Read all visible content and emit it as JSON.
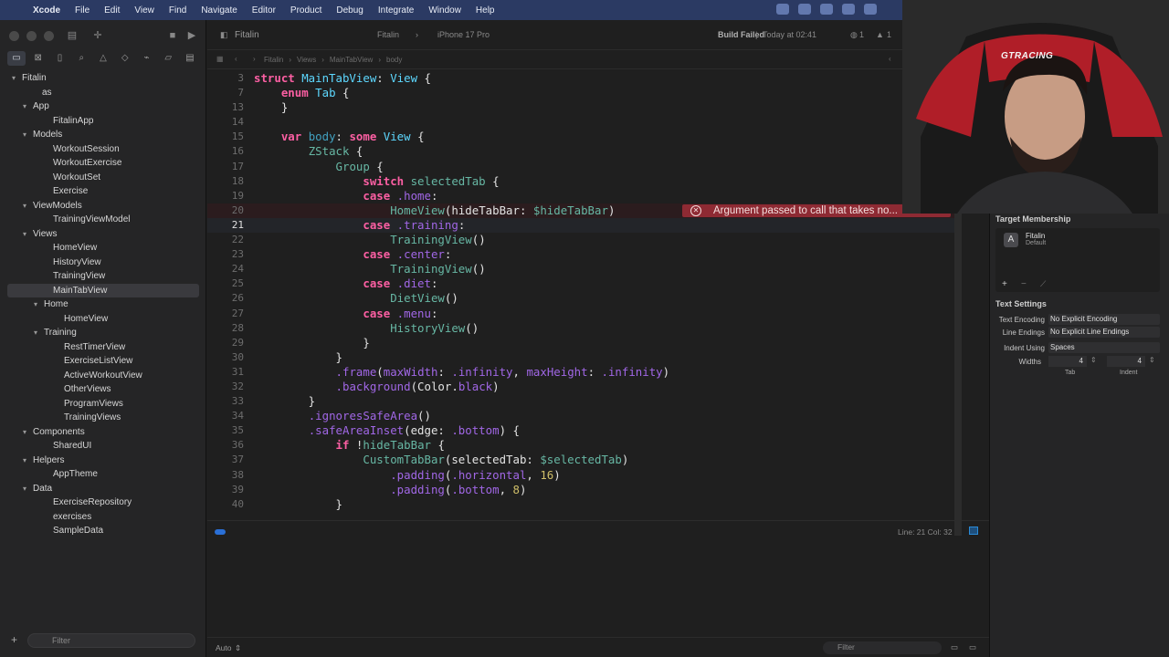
{
  "menubar": {
    "app": "Xcode",
    "items": [
      "File",
      "Edit",
      "View",
      "Find",
      "Navigate",
      "Editor",
      "Product",
      "Debug",
      "Integrate",
      "Window",
      "Help"
    ]
  },
  "toolbar": {
    "scheme": "Fitalin",
    "destination_target": "Fitalin",
    "destination_device": "iPhone 17 Pro",
    "status": "Build Failed",
    "status_time": "Today at 02:41",
    "warnings": "1",
    "errors": "1"
  },
  "navigator": {
    "filter_placeholder": "Filter",
    "items": [
      {
        "label": "Fitalin",
        "depth": 0,
        "folder": true,
        "open": true
      },
      {
        "label": "as",
        "depth": 1,
        "folder": false
      },
      {
        "label": "App",
        "depth": 1,
        "folder": true,
        "open": true
      },
      {
        "label": "FitalinApp",
        "depth": 2,
        "folder": false
      },
      {
        "label": "Models",
        "depth": 1,
        "folder": true,
        "open": true
      },
      {
        "label": "WorkoutSession",
        "depth": 2,
        "folder": false
      },
      {
        "label": "WorkoutExercise",
        "depth": 2,
        "folder": false
      },
      {
        "label": "WorkoutSet",
        "depth": 2,
        "folder": false
      },
      {
        "label": "Exercise",
        "depth": 2,
        "folder": false
      },
      {
        "label": "ViewModels",
        "depth": 1,
        "folder": true,
        "open": true
      },
      {
        "label": "TrainingViewModel",
        "depth": 2,
        "folder": false
      },
      {
        "label": "Views",
        "depth": 1,
        "folder": true,
        "open": true
      },
      {
        "label": "HomeView",
        "depth": 2,
        "folder": false
      },
      {
        "label": "HistoryView",
        "depth": 2,
        "folder": false
      },
      {
        "label": "TrainingView",
        "depth": 2,
        "folder": false
      },
      {
        "label": "MainTabView",
        "depth": 2,
        "folder": false,
        "selected": true
      },
      {
        "label": "Home",
        "depth": 2,
        "folder": true,
        "open": true
      },
      {
        "label": "HomeView",
        "depth": 3,
        "folder": false
      },
      {
        "label": "Training",
        "depth": 2,
        "folder": true,
        "open": true
      },
      {
        "label": "RestTimerView",
        "depth": 3,
        "folder": false
      },
      {
        "label": "ExerciseListView",
        "depth": 3,
        "folder": false
      },
      {
        "label": "ActiveWorkoutView",
        "depth": 3,
        "folder": false
      },
      {
        "label": "OtherViews",
        "depth": 3,
        "folder": false
      },
      {
        "label": "ProgramViews",
        "depth": 3,
        "folder": false
      },
      {
        "label": "TrainingViews",
        "depth": 3,
        "folder": false
      },
      {
        "label": "Components",
        "depth": 1,
        "folder": true,
        "open": true
      },
      {
        "label": "SharedUI",
        "depth": 2,
        "folder": false
      },
      {
        "label": "Helpers",
        "depth": 1,
        "folder": true,
        "open": true
      },
      {
        "label": "AppTheme",
        "depth": 2,
        "folder": false
      },
      {
        "label": "Data",
        "depth": 1,
        "folder": true,
        "open": true
      },
      {
        "label": "ExerciseRepository",
        "depth": 2,
        "folder": false
      },
      {
        "label": "exercises",
        "depth": 2,
        "folder": false
      },
      {
        "label": "SampleData",
        "depth": 2,
        "folder": false
      }
    ]
  },
  "editor": {
    "tab_file": "Fitalin",
    "jumpbar": [
      "Fitalin",
      "Views",
      "MainTabView",
      "body"
    ],
    "cursor": "Line: 21  Col: 32",
    "editor_mode": "Auto",
    "bottom_filter_placeholder": "Filter",
    "error_message": "Argument passed to call that takes no...",
    "lines": [
      {
        "n": "3",
        "tokens": [
          [
            "kw",
            "struct "
          ],
          [
            "ty",
            "MainTabView"
          ],
          [
            "pl",
            ": "
          ],
          [
            "ty",
            "View"
          ],
          [
            "pl",
            " {"
          ]
        ]
      },
      {
        "n": "7",
        "tokens": [
          [
            "pl",
            "    "
          ],
          [
            "kw",
            "enum "
          ],
          [
            "ty",
            "Tab"
          ],
          [
            "pl",
            " {"
          ]
        ]
      },
      {
        "n": "13",
        "tokens": [
          [
            "pl",
            "    }"
          ]
        ]
      },
      {
        "n": "14",
        "tokens": []
      },
      {
        "n": "15",
        "tokens": [
          [
            "pl",
            "    "
          ],
          [
            "kw",
            "var "
          ],
          [
            "bd",
            "body"
          ],
          [
            "pl",
            ": "
          ],
          [
            "kw",
            "some "
          ],
          [
            "ty",
            "View"
          ],
          [
            "pl",
            " {"
          ]
        ]
      },
      {
        "n": "16",
        "tokens": [
          [
            "pl",
            "        "
          ],
          [
            "fn",
            "ZStack"
          ],
          [
            "pl",
            " {"
          ]
        ]
      },
      {
        "n": "17",
        "tokens": [
          [
            "pl",
            "            "
          ],
          [
            "fn",
            "Group"
          ],
          [
            "pl",
            " {"
          ]
        ]
      },
      {
        "n": "18",
        "tokens": [
          [
            "pl",
            "                "
          ],
          [
            "kw",
            "switch "
          ],
          [
            "fn",
            "selectedTab"
          ],
          [
            "pl",
            " {"
          ]
        ]
      },
      {
        "n": "19",
        "tokens": [
          [
            "pl",
            "                "
          ],
          [
            "kw",
            "case "
          ],
          [
            "pr",
            ".home"
          ],
          [
            "pl",
            ":"
          ]
        ]
      },
      {
        "n": "20",
        "tokens": [
          [
            "pl",
            "                    "
          ],
          [
            "fn",
            "HomeView"
          ],
          [
            "pl",
            "(hideTabBar: "
          ],
          [
            "fn",
            "$hideTabBar"
          ],
          [
            "pl",
            ")"
          ]
        ],
        "error": true
      },
      {
        "n": "21",
        "tokens": [
          [
            "pl",
            "                "
          ],
          [
            "kw",
            "case "
          ],
          [
            "pr",
            ".training"
          ],
          [
            "pl",
            ":"
          ]
        ],
        "current": true
      },
      {
        "n": "22",
        "tokens": [
          [
            "pl",
            "                    "
          ],
          [
            "fn",
            "TrainingView"
          ],
          [
            "pl",
            "()"
          ]
        ]
      },
      {
        "n": "23",
        "tokens": [
          [
            "pl",
            "                "
          ],
          [
            "kw",
            "case "
          ],
          [
            "pr",
            ".center"
          ],
          [
            "pl",
            ":"
          ]
        ]
      },
      {
        "n": "24",
        "tokens": [
          [
            "pl",
            "                    "
          ],
          [
            "fn",
            "TrainingView"
          ],
          [
            "pl",
            "()"
          ]
        ]
      },
      {
        "n": "25",
        "tokens": [
          [
            "pl",
            "                "
          ],
          [
            "kw",
            "case "
          ],
          [
            "pr",
            ".diet"
          ],
          [
            "pl",
            ":"
          ]
        ]
      },
      {
        "n": "26",
        "tokens": [
          [
            "pl",
            "                    "
          ],
          [
            "fn",
            "DietView"
          ],
          [
            "pl",
            "()"
          ]
        ]
      },
      {
        "n": "27",
        "tokens": [
          [
            "pl",
            "                "
          ],
          [
            "kw",
            "case "
          ],
          [
            "pr",
            ".menu"
          ],
          [
            "pl",
            ":"
          ]
        ]
      },
      {
        "n": "28",
        "tokens": [
          [
            "pl",
            "                    "
          ],
          [
            "fn",
            "HistoryView"
          ],
          [
            "pl",
            "()"
          ]
        ]
      },
      {
        "n": "29",
        "tokens": [
          [
            "pl",
            "                }"
          ]
        ]
      },
      {
        "n": "30",
        "tokens": [
          [
            "pl",
            "            }"
          ]
        ]
      },
      {
        "n": "31",
        "tokens": [
          [
            "pl",
            "            "
          ],
          [
            "pr",
            ".frame"
          ],
          [
            "pl",
            "("
          ],
          [
            "pr",
            "maxWidth"
          ],
          [
            "pl",
            ": "
          ],
          [
            "pr",
            ".infinity"
          ],
          [
            "pl",
            ", "
          ],
          [
            "pr",
            "maxHeight"
          ],
          [
            "pl",
            ": "
          ],
          [
            "pr",
            ".infinity"
          ],
          [
            "pl",
            ")"
          ]
        ]
      },
      {
        "n": "32",
        "tokens": [
          [
            "pl",
            "            "
          ],
          [
            "pr",
            ".background"
          ],
          [
            "pl",
            "(Color."
          ],
          [
            "pr",
            "black"
          ],
          [
            "pl",
            ")"
          ]
        ]
      },
      {
        "n": "33",
        "tokens": [
          [
            "pl",
            "        }"
          ]
        ]
      },
      {
        "n": "34",
        "tokens": [
          [
            "pl",
            "        "
          ],
          [
            "pr",
            ".ignoresSafeArea"
          ],
          [
            "pl",
            "()"
          ]
        ]
      },
      {
        "n": "35",
        "tokens": [
          [
            "pl",
            "        "
          ],
          [
            "pr",
            ".safeAreaInset"
          ],
          [
            "pl",
            "(edge: "
          ],
          [
            "pr",
            ".bottom"
          ],
          [
            "pl",
            ") {"
          ]
        ]
      },
      {
        "n": "36",
        "tokens": [
          [
            "pl",
            "            "
          ],
          [
            "kw",
            "if "
          ],
          [
            "pl",
            "!"
          ],
          [
            "fn",
            "hideTabBar"
          ],
          [
            "pl",
            " {"
          ]
        ]
      },
      {
        "n": "37",
        "tokens": [
          [
            "pl",
            "                "
          ],
          [
            "fn",
            "CustomTabBar"
          ],
          [
            "pl",
            "(selectedTab: "
          ],
          [
            "fn",
            "$selectedTab"
          ],
          [
            "pl",
            ")"
          ]
        ]
      },
      {
        "n": "38",
        "tokens": [
          [
            "pl",
            "                    "
          ],
          [
            "pr",
            ".padding"
          ],
          [
            "pl",
            "("
          ],
          [
            "pr",
            ".horizontal"
          ],
          [
            "pl",
            ", "
          ],
          [
            "nu",
            "16"
          ],
          [
            "pl",
            ")"
          ]
        ]
      },
      {
        "n": "39",
        "tokens": [
          [
            "pl",
            "                    "
          ],
          [
            "pr",
            ".padding"
          ],
          [
            "pl",
            "("
          ],
          [
            "pr",
            ".bottom"
          ],
          [
            "pl",
            ", "
          ],
          [
            "nu",
            "8"
          ],
          [
            "pl",
            ")"
          ]
        ]
      },
      {
        "n": "40",
        "tokens": [
          [
            "pl",
            "            }"
          ]
        ]
      }
    ]
  },
  "inspector": {
    "target_membership_title": "Target Membership",
    "target_name": "Fitalin",
    "target_sub": "Default",
    "text_settings_title": "Text Settings",
    "encoding_label": "Text Encoding",
    "encoding_value": "No Explicit Encoding",
    "line_endings_label": "Line Endings",
    "line_endings_value": "No Explicit Line Endings",
    "indent_using_label": "Indent Using",
    "indent_using_value": "Spaces",
    "widths_label": "Widths",
    "tab_width": "4",
    "indent_width": "4",
    "tab_label": "Tab",
    "indent_label": "Indent"
  },
  "webcam": {
    "logo_text": "GTRACING"
  },
  "colors": {
    "menubar": "#2b3a63",
    "error": "#8e2a33",
    "keyword": "#fc5fa3",
    "type": "#5dd8ff"
  }
}
